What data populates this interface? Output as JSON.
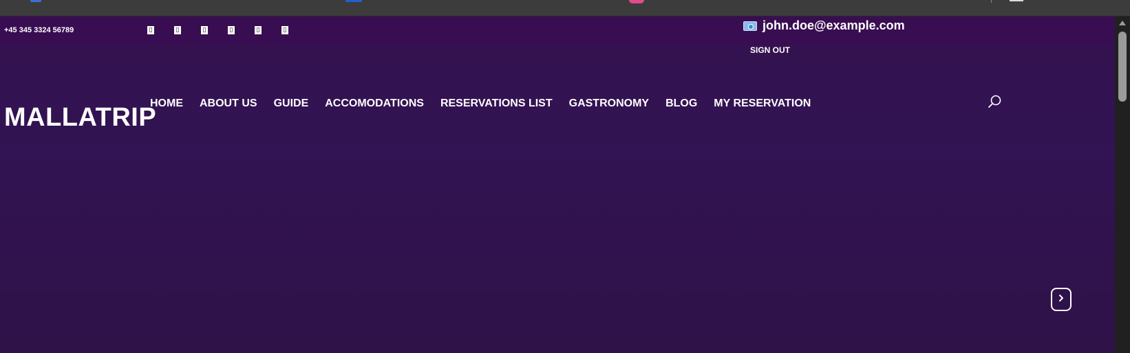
{
  "topbar": {
    "phone": "+45 345 3324 56789",
    "social_icons": [
      "social-icon-1",
      "social-icon-2",
      "social-icon-3",
      "social-icon-4",
      "social-icon-5",
      "social-icon-6"
    ],
    "social_glyph": "▯",
    "email": "john.doe@example.com",
    "sign_out": "SIGN OUT"
  },
  "header": {
    "brand": "MALLATRIP",
    "nav": [
      "HOME",
      "ABOUT US",
      "GUIDE",
      "ACCOMODATIONS",
      "RESERVATIONS LIST",
      "GASTRONOMY",
      "BLOG",
      "MY RESERVATION"
    ]
  },
  "icons": {
    "search": "search-icon",
    "next": "chevron-right-icon",
    "mail": "mail-icon"
  },
  "colors": {
    "topbar_bg": "#390d52",
    "page_bg": "#311350",
    "text": "#ffffff"
  }
}
